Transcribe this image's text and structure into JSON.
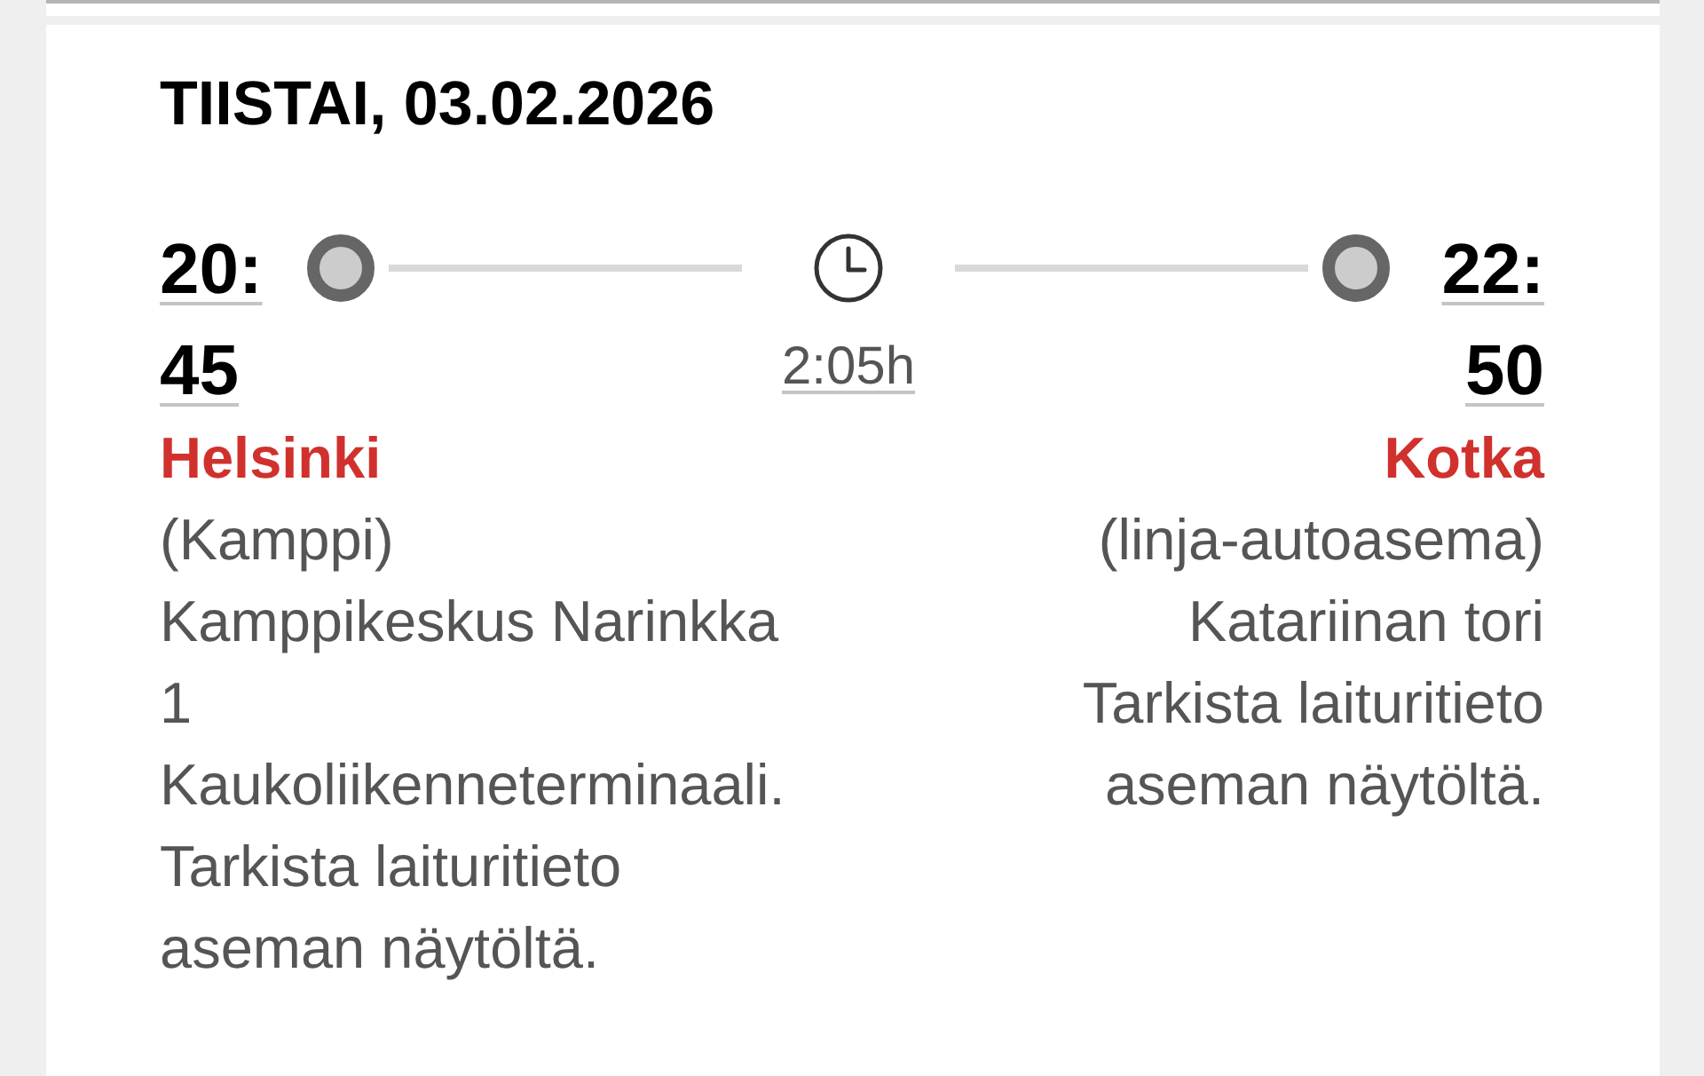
{
  "date_heading": "TIISTAI, 03.02.2026",
  "journey": {
    "departure": {
      "time": "20:45",
      "city": "Helsinki",
      "station": "(Kamppi)",
      "address": "Kamppikeskus Narinkka 1",
      "note": "Kaukoliikenneterminaali. Tarkista laituritieto aseman näytöltä."
    },
    "duration": "2:05h",
    "arrival": {
      "time": "22:50",
      "city": "Kotka",
      "station": "(linja-autoasema)",
      "address": "Katariinan tori",
      "note": "Tarkista laituritieto aseman näytöltä."
    }
  }
}
